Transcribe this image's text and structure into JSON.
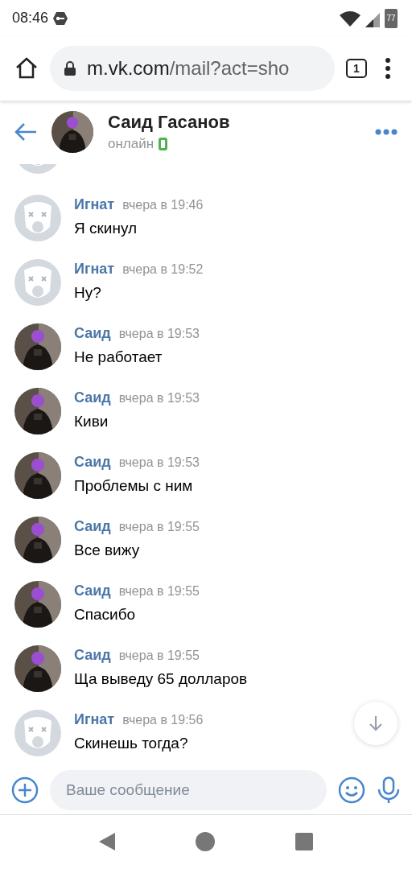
{
  "status_bar": {
    "time": "08:46",
    "battery": "77"
  },
  "browser": {
    "url_host": "m.vk.com",
    "url_path": "/mail?act=sho",
    "tab_count": "1"
  },
  "header": {
    "name": "Саид Гасанов",
    "status": "онлайн"
  },
  "messages": [
    {
      "author": "Игнат",
      "time": "вчера в 19:46",
      "text": "Я скинул",
      "avatar": {
        "kind": "deleted"
      }
    },
    {
      "author": "Игнат",
      "time": "вчера в 19:52",
      "text": "Ну?",
      "avatar": {
        "kind": "deleted"
      }
    },
    {
      "author": "Саид",
      "time": "вчера в 19:53",
      "text": "Не работает"
    },
    {
      "author": "Саид",
      "time": "вчера в 19:53",
      "text": "Киви"
    },
    {
      "author": "Саид",
      "time": "вчера в 19:53",
      "text": "Проблемы с ним"
    },
    {
      "author": "Саид",
      "time": "вчера в 19:55",
      "text": "Все вижу"
    },
    {
      "author": "Саид",
      "time": "вчера в 19:55",
      "text": "Спасибо"
    },
    {
      "author": "Саид",
      "time": "вчера в 19:55",
      "text": "Ща выведу 65 долларов"
    },
    {
      "author": "Игнат",
      "time": "вчера в 19:56",
      "text": "Скинешь тогда?",
      "avatar": {
        "kind": "deleted"
      }
    }
  ],
  "composer": {
    "placeholder": "Ваше сообщение"
  }
}
